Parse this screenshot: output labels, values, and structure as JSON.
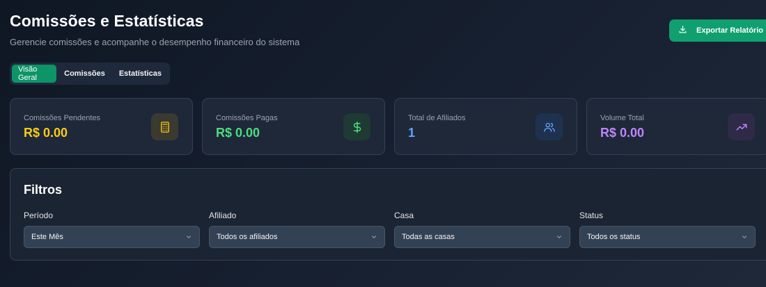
{
  "header": {
    "title": "Comissões e Estatísticas",
    "subtitle": "Gerencie comissões e acompanhe o desempenho financeiro do sistema",
    "export_label": "Exportar Relatório"
  },
  "tabs": [
    {
      "label": "Visão Geral",
      "active": true
    },
    {
      "label": "Comissões",
      "active": false
    },
    {
      "label": "Estatísticas",
      "active": false
    }
  ],
  "stats": [
    {
      "label": "Comissões Pendentes",
      "value": "R$ 0.00",
      "color": "#facc15",
      "icon": "calculator-icon",
      "icon_bg": "#3a3a30"
    },
    {
      "label": "Comissões Pagas",
      "value": "R$ 0.00",
      "color": "#4ade80",
      "icon": "dollar-icon",
      "icon_bg": "#1e3a32"
    },
    {
      "label": "Total de Afiliados",
      "value": "1",
      "color": "#60a5fa",
      "icon": "users-icon",
      "icon_bg": "#1e3250"
    },
    {
      "label": "Volume Total",
      "value": "R$ 0.00",
      "color": "#c084fc",
      "icon": "trending-up-icon",
      "icon_bg": "#2e2a48"
    }
  ],
  "filters": {
    "title": "Filtros",
    "items": [
      {
        "label": "Período",
        "value": "Este Mês"
      },
      {
        "label": "Afiliado",
        "value": "Todos os afiliados"
      },
      {
        "label": "Casa",
        "value": "Todas as casas"
      },
      {
        "label": "Status",
        "value": "Todos os status"
      }
    ]
  }
}
